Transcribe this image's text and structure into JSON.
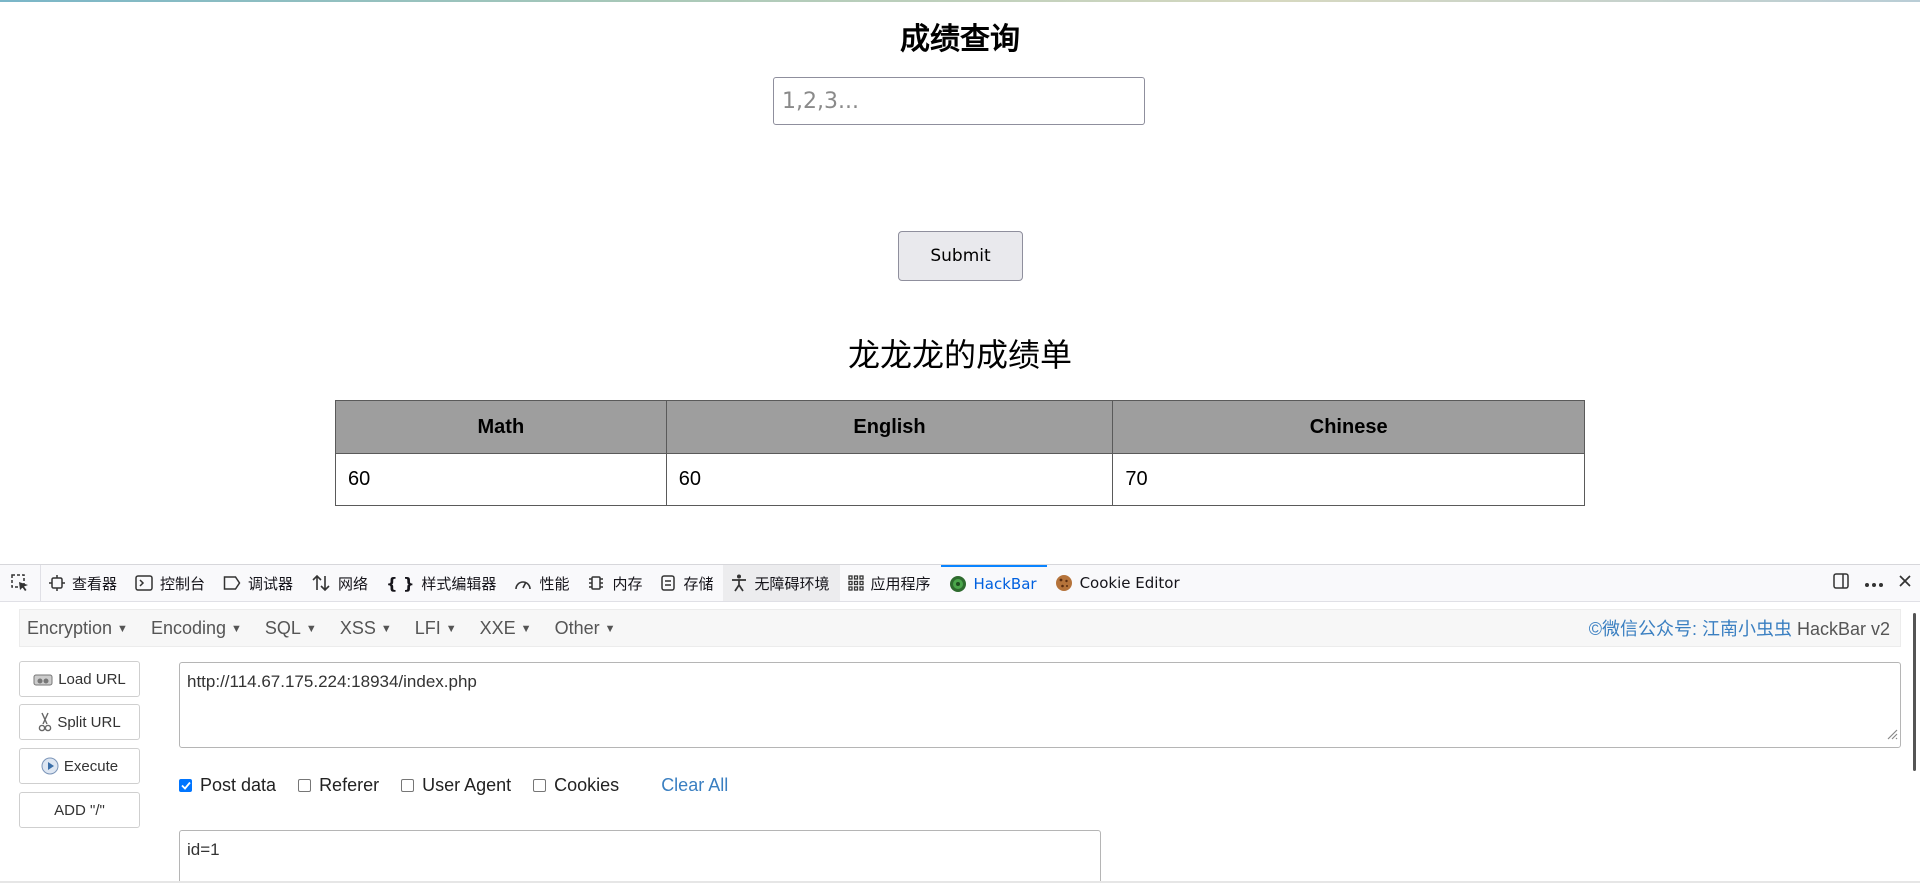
{
  "page": {
    "title": "成绩查询",
    "input_placeholder": "1,2,3...",
    "submit_label": "Submit",
    "report_heading": "龙龙龙的成绩单",
    "table": {
      "headers": [
        "Math",
        "English",
        "Chinese"
      ],
      "rows": [
        [
          "60",
          "60",
          "70"
        ]
      ]
    }
  },
  "devtools": {
    "tabs": [
      {
        "label": "查看器",
        "icon": "inspector-icon"
      },
      {
        "label": "控制台",
        "icon": "console-icon"
      },
      {
        "label": "调试器",
        "icon": "debugger-icon"
      },
      {
        "label": "网络",
        "icon": "network-icon"
      },
      {
        "label": "样式编辑器",
        "icon": "style-editor-icon"
      },
      {
        "label": "性能",
        "icon": "performance-icon"
      },
      {
        "label": "内存",
        "icon": "memory-icon"
      },
      {
        "label": "存储",
        "icon": "storage-icon"
      },
      {
        "label": "无障碍环境",
        "icon": "accessibility-icon"
      },
      {
        "label": "应用程序",
        "icon": "application-icon"
      },
      {
        "label": "HackBar",
        "icon": "hackbar-icon",
        "active": true
      },
      {
        "label": "Cookie Editor",
        "icon": "cookie-icon"
      }
    ]
  },
  "hackbar": {
    "menu": [
      "Encryption",
      "Encoding",
      "SQL",
      "XSS",
      "LFI",
      "XXE",
      "Other"
    ],
    "brand_prefix": "©微信公众号: 江南小虫虫",
    "brand_suffix": " HackBar v2",
    "buttons": {
      "load_url": "Load URL",
      "split_url": "Split URL",
      "execute": "Execute",
      "add_slash": "ADD \"/\""
    },
    "url_value": "http://114.67.175.224:18934/index.php",
    "options": {
      "post_data": {
        "label": "Post data",
        "checked": true
      },
      "referer": {
        "label": "Referer",
        "checked": false
      },
      "user_agent": {
        "label": "User Agent",
        "checked": false
      },
      "cookies": {
        "label": "Cookies",
        "checked": false
      }
    },
    "clear_all": "Clear All",
    "post_value": "id=1"
  },
  "colors": {
    "accent": "#0a84ff",
    "link": "#3a7fc1",
    "table_header": "#9e9e9e"
  }
}
